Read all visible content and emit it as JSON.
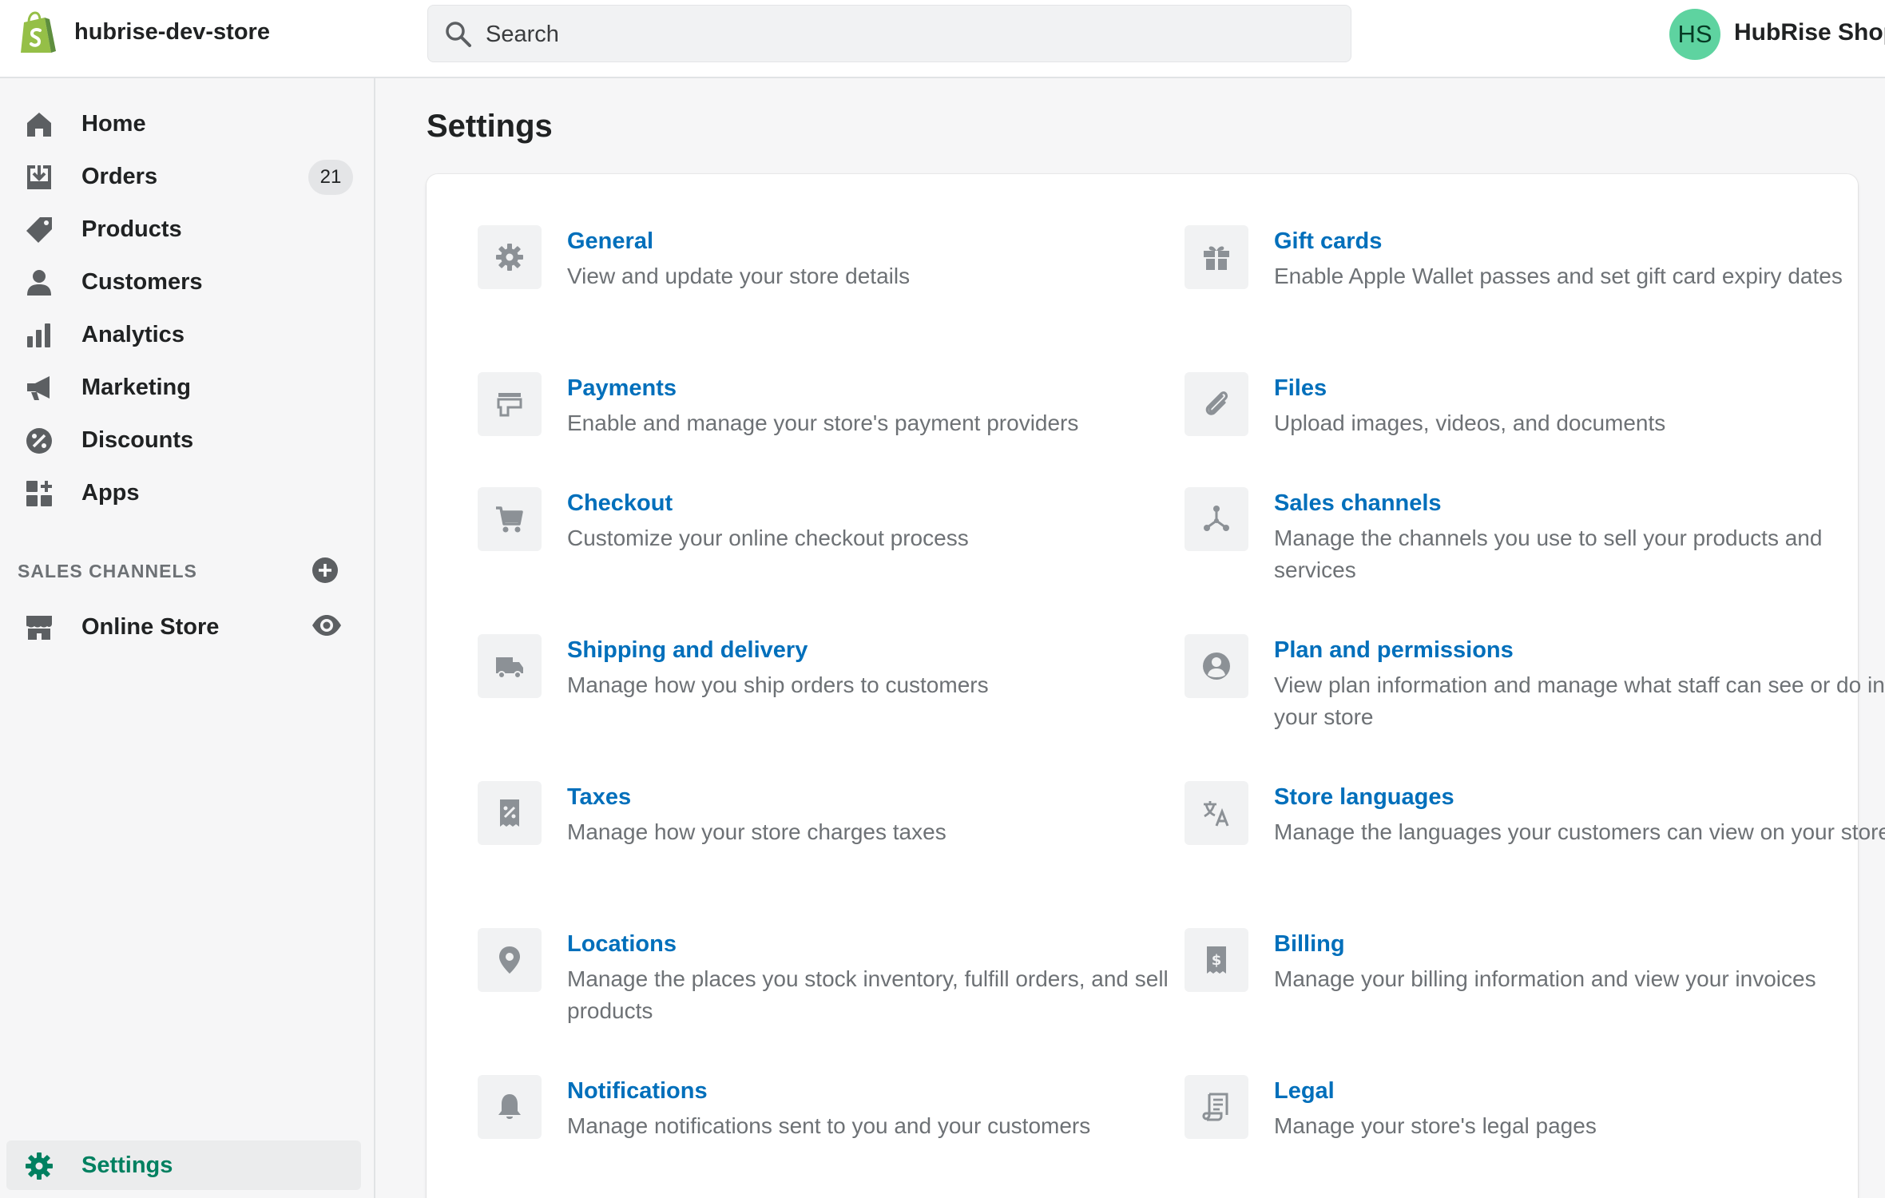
{
  "topbar": {
    "store_name": "hubrise-dev-store",
    "search_placeholder": "Search",
    "avatar_initials": "HS",
    "user_name": "HubRise Shop"
  },
  "sidebar": {
    "items": [
      {
        "label": "Home",
        "icon": "home-icon"
      },
      {
        "label": "Orders",
        "icon": "orders-icon",
        "badge": "21"
      },
      {
        "label": "Products",
        "icon": "tag-icon"
      },
      {
        "label": "Customers",
        "icon": "person-icon"
      },
      {
        "label": "Analytics",
        "icon": "bar-chart-icon"
      },
      {
        "label": "Marketing",
        "icon": "megaphone-icon"
      },
      {
        "label": "Discounts",
        "icon": "discount-icon"
      },
      {
        "label": "Apps",
        "icon": "apps-icon"
      }
    ],
    "sales_channels_heading": "SALES CHANNELS",
    "online_store": "Online Store",
    "settings": "Settings"
  },
  "main": {
    "title": "Settings",
    "settings_left": [
      {
        "title": "General",
        "desc": "View and update your store details",
        "icon": "gear-icon"
      },
      {
        "title": "Payments",
        "desc": "Enable and manage your store's payment providers",
        "icon": "payments-icon"
      },
      {
        "title": "Checkout",
        "desc": "Customize your online checkout process",
        "icon": "cart-icon"
      },
      {
        "title": "Shipping and delivery",
        "desc": "Manage how you ship orders to customers",
        "icon": "truck-icon"
      },
      {
        "title": "Taxes",
        "desc": "Manage how your store charges taxes",
        "icon": "tax-receipt-icon"
      },
      {
        "title": "Locations",
        "desc": "Manage the places you stock inventory, fulfill orders, and sell products",
        "icon": "location-pin-icon"
      },
      {
        "title": "Notifications",
        "desc": "Manage notifications sent to you and your customers",
        "icon": "bell-icon"
      }
    ],
    "settings_right": [
      {
        "title": "Gift cards",
        "desc": "Enable Apple Wallet passes and set gift card expiry dates",
        "icon": "gift-icon"
      },
      {
        "title": "Files",
        "desc": "Upload images, videos, and documents",
        "icon": "paperclip-icon"
      },
      {
        "title": "Sales channels",
        "desc": "Manage the channels you use to sell your products and services",
        "icon": "channels-icon"
      },
      {
        "title": "Plan and permissions",
        "desc": "View plan information and manage what staff can see or do in your store",
        "icon": "user-circle-icon"
      },
      {
        "title": "Store languages",
        "desc": "Manage the languages your customers can view on your store",
        "icon": "translate-icon"
      },
      {
        "title": "Billing",
        "desc": "Manage your billing information and view your invoices",
        "icon": "billing-icon"
      },
      {
        "title": "Legal",
        "desc": "Manage your store's legal pages",
        "icon": "legal-icon"
      }
    ]
  },
  "colors": {
    "link": "#006fbb",
    "brand_green": "#008060",
    "icon_gray": "#8c9196",
    "avatar_bg": "#5ed3a0"
  }
}
